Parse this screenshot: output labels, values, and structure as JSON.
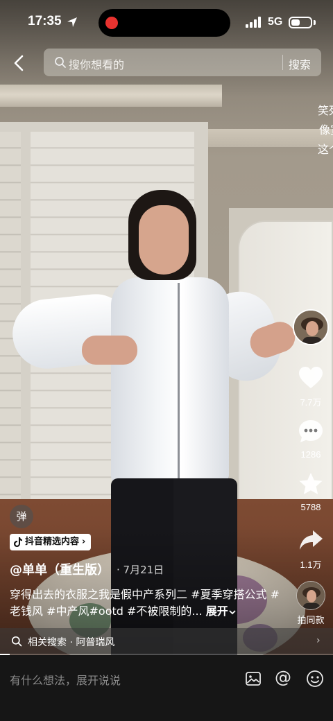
{
  "status_bar": {
    "time": "17:35",
    "network": "5G",
    "battery_level": 0.45
  },
  "search": {
    "placeholder": "搜你想看的",
    "button_label": "搜索"
  },
  "floating_comment": [
    "笑死",
    "像宣",
    "这个"
  ],
  "actions": {
    "like_count": "7.7万",
    "comment_count": "1286",
    "favorite_count": "5788",
    "share_count": "1.1万",
    "shoot_same_label": "拍同款"
  },
  "video": {
    "danmu_label": "弹",
    "pick_badge": "抖音精选内容",
    "author": "@单单（重生版）",
    "date": "· 7月21日",
    "description": "穿得出去的衣服之我是假中产系列二 #夏季穿搭公式 #老钱风 #中产风#ootd #不被限制的...",
    "expand_label": "展开",
    "related_search": "相关搜索 · 阿普瑞风",
    "progress": 0.03
  },
  "comment_bar": {
    "placeholder": "有什么想法，展开说说"
  },
  "icons": {
    "back": "chevron-left-icon",
    "search": "search-icon",
    "like": "heart-icon",
    "comment": "comment-bubble-icon",
    "favorite": "star-icon",
    "share": "share-arrow-icon",
    "image": "image-icon",
    "mention": "at-icon",
    "emoji": "emoji-icon"
  }
}
